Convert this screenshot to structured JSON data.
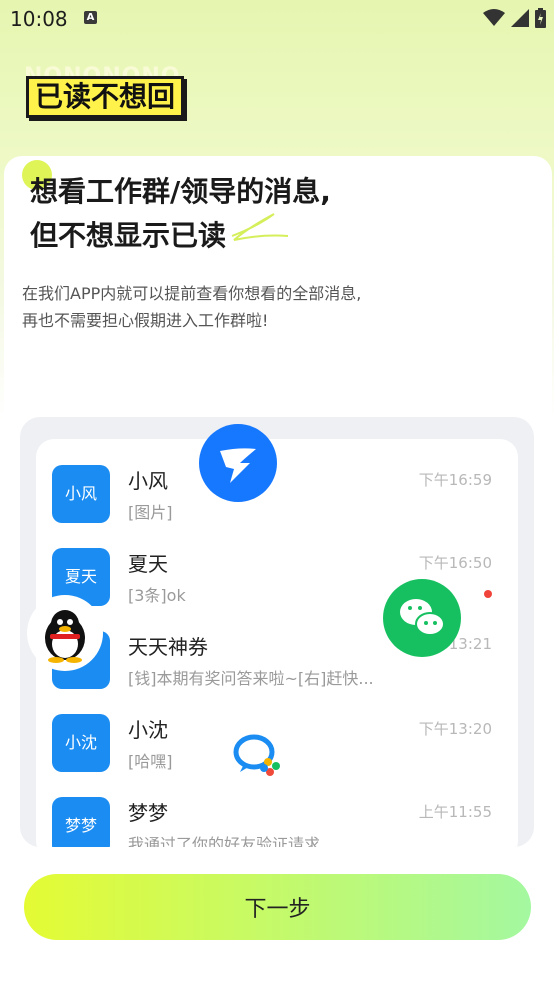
{
  "status_bar": {
    "time": "10:08",
    "notification_icon": "A"
  },
  "brand": {
    "title": "已读不想回",
    "background_text": "NONONONO"
  },
  "headline": {
    "line1": "想看工作群/领导的消息,",
    "line2": "但不想显示已读"
  },
  "description": {
    "line1": "在我们APP内就可以提前查看你想看的全部消息,",
    "line2": "再也不需要担心假期进入工作群啦!"
  },
  "chats": [
    {
      "avatar": "小风",
      "name": "小风",
      "message": "[图片]",
      "time": "下午16:59",
      "unread": false
    },
    {
      "avatar": "夏天",
      "name": "夏天",
      "message": "[3条]ok",
      "time": "下午16:50",
      "unread": true
    },
    {
      "avatar": "",
      "name": "天天神券",
      "message": "[钱]本期有奖问答来啦~[右]赶快...",
      "time": "13:21",
      "unread": false
    },
    {
      "avatar": "小沈",
      "name": "小沈",
      "message": "[哈嘿]",
      "time": "下午13:20",
      "unread": false
    },
    {
      "avatar": "梦梦",
      "name": "梦梦",
      "message": "我通过了你的好友验证请求",
      "time": "上午11:55",
      "unread": false
    }
  ],
  "floating_icons": [
    "dingtalk-icon",
    "qq-icon",
    "wechat-icon",
    "wecom-icon"
  ],
  "next_button": "下一步",
  "colors": {
    "accent_blue": "#1a8cf2",
    "button_start": "#e4fb34",
    "button_end": "#a4f8a0",
    "unread": "#f0443a"
  }
}
